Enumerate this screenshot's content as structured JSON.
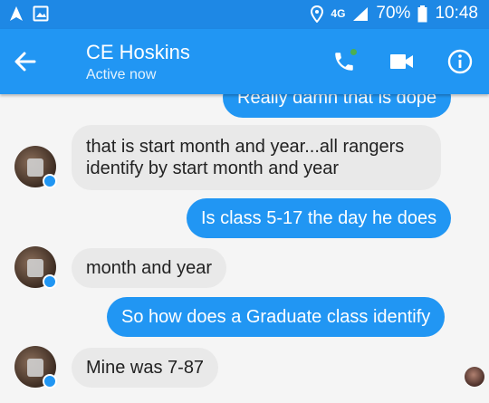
{
  "status_bar": {
    "network": "4G",
    "battery": "70%",
    "time": "10:48"
  },
  "header": {
    "contact_name": "CE Hoskins",
    "contact_status": "Active now"
  },
  "messages": [
    {
      "side": "sent",
      "text": "Really damn that is dope"
    },
    {
      "side": "received",
      "text_line1": "that is start month and year...all rangers",
      "text_line2": "identify by start month and year"
    },
    {
      "side": "sent",
      "text": "Is class 5-17 the day he does"
    },
    {
      "side": "received",
      "text": "month and year"
    },
    {
      "side": "sent",
      "text": "So how does a Graduate class identify"
    },
    {
      "side": "received",
      "text": "Mine was 7-87"
    }
  ],
  "colors": {
    "status_bar": "#1e88e5",
    "app_bar": "#2196f3",
    "sent_bubble": "#2196f3",
    "received_bubble": "#e9e9e9",
    "online": "#4caf50"
  }
}
